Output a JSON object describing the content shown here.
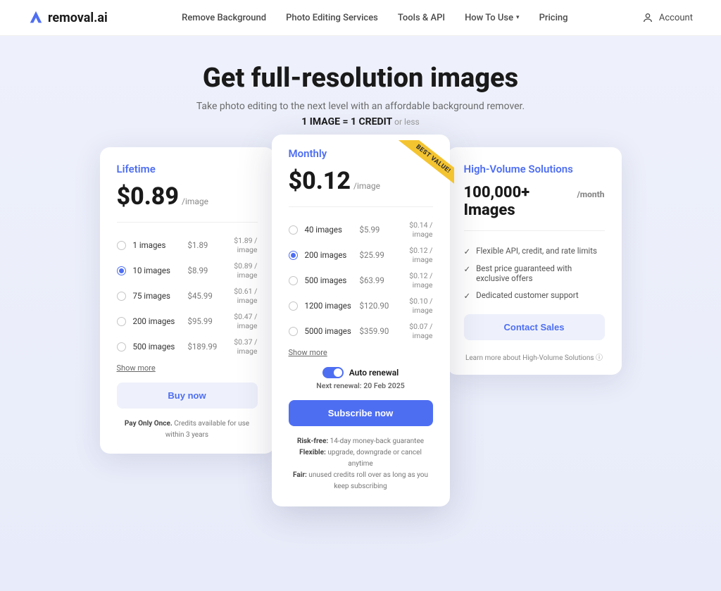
{
  "brand": "removal.ai",
  "nav": {
    "remove_bg": "Remove Background",
    "photo_editing": "Photo Editing Services",
    "tools_api": "Tools & API",
    "how_to_use": "How To Use",
    "pricing": "Pricing"
  },
  "account_label": "Account",
  "hero": {
    "title": "Get full-resolution images",
    "subtitle": "Take photo editing to the next level with an affordable background remover.",
    "equation_bold": "1 IMAGE = 1 CREDIT",
    "equation_muted": " or less"
  },
  "lifetime": {
    "title": "Lifetime",
    "price": "$0.89",
    "per": "/image",
    "options": [
      {
        "name": "1 images",
        "price": "$1.89",
        "per": "$1.89 / image",
        "selected": false
      },
      {
        "name": "10 images",
        "price": "$8.99",
        "per": "$0.89 / image",
        "selected": true
      },
      {
        "name": "75 images",
        "price": "$45.99",
        "per": "$0.61 / image",
        "selected": false
      },
      {
        "name": "200 images",
        "price": "$95.99",
        "per": "$0.47 / image",
        "selected": false
      },
      {
        "name": "500 images",
        "price": "$189.99",
        "per": "$0.37 / image",
        "selected": false
      }
    ],
    "show_more": "Show more",
    "cta": "Buy now",
    "fine_bold": "Pay Only Once.",
    "fine_rest": " Credits available for use within 3 years"
  },
  "monthly": {
    "title": "Monthly",
    "ribbon": "BEST VALUE!",
    "price": "$0.12",
    "per": "/image",
    "options": [
      {
        "name": "40 images",
        "price": "$5.99",
        "per": "$0.14 / image",
        "selected": false
      },
      {
        "name": "200 images",
        "price": "$25.99",
        "per": "$0.12 / image",
        "selected": true
      },
      {
        "name": "500 images",
        "price": "$63.99",
        "per": "$0.12 / image",
        "selected": false
      },
      {
        "name": "1200 images",
        "price": "$120.90",
        "per": "$0.10 / image",
        "selected": false
      },
      {
        "name": "5000 images",
        "price": "$359.90",
        "per": "$0.07 / image",
        "selected": false
      }
    ],
    "show_more": "Show more",
    "auto_renewal": "Auto renewal",
    "next_renewal": "Next renewal: 20 Feb 2025",
    "cta": "Subscribe now",
    "fine1_b": "Risk-free:",
    "fine1_r": " 14-day money-back guarantee",
    "fine2_b": "Flexible:",
    "fine2_r": " upgrade, downgrade or cancel anytime",
    "fine3_b": "Fair:",
    "fine3_r": " unused credits roll over as long as you keep subscribing"
  },
  "high": {
    "title": "High-Volume Solutions",
    "amount": "100,000+ Images",
    "per": "/month",
    "benefits": [
      "Flexible API, credit, and rate limits",
      "Best price guaranteed with exclusive offers",
      "Dedicated customer support"
    ],
    "cta": "Contact Sales",
    "learn": "Learn more about High-Volume Solutions ⓘ"
  }
}
